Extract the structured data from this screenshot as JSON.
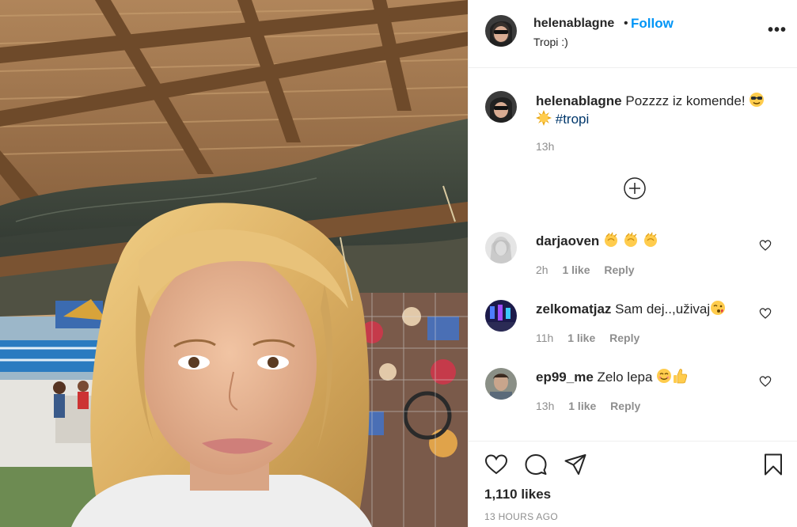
{
  "post": {
    "username": "helenablagne",
    "follow_label": "Follow",
    "separator": "•",
    "location": "Tropi :)",
    "more_label": "•••"
  },
  "caption": {
    "username": "helenablagne",
    "text": "Pozzzz iz komende!",
    "emojis": [
      "sunglasses-emoji",
      "sun-emoji"
    ],
    "hashtag": "#tropi",
    "time": "13h"
  },
  "comments": [
    {
      "username": "darjaoven",
      "text": "",
      "emojis": [
        "clap",
        "clap",
        "clap"
      ],
      "time": "2h",
      "likes": "1 like",
      "reply": "Reply"
    },
    {
      "username": "zelkomatjaz",
      "text": "Sam dej..,uživaj",
      "emojis": [
        "kiss"
      ],
      "time": "11h",
      "likes": "1 like",
      "reply": "Reply"
    },
    {
      "username": "ep99_me",
      "text": "Zelo lepa",
      "emojis": [
        "smile",
        "thumbs-up"
      ],
      "time": "13h",
      "likes": "1 like",
      "reply": "Reply"
    }
  ],
  "footer": {
    "likes": "1,110 likes",
    "time_ago": "13 HOURS AGO"
  },
  "colors": {
    "follow": "#0095f6",
    "hashtag": "#00376b",
    "muted": "#8e8e8e",
    "text": "#262626"
  }
}
